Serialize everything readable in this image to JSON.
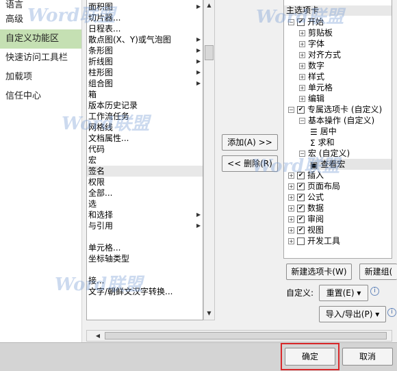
{
  "nav": {
    "items": [
      {
        "label": "语言",
        "selected": false
      },
      {
        "label": "高级",
        "selected": false
      },
      {
        "label": "自定义功能区",
        "selected": true
      },
      {
        "label": "快速访问工具栏",
        "selected": false
      },
      {
        "label": "加载项",
        "selected": false
      },
      {
        "label": "信任中心",
        "selected": false
      }
    ]
  },
  "commands": [
    {
      "label": "面积图",
      "arrow": true
    },
    {
      "label": "切片器...",
      "arrow": false
    },
    {
      "label": "日程表...",
      "arrow": false
    },
    {
      "label": "散点图(X、Y)或气泡图",
      "arrow": true
    },
    {
      "label": "条形图",
      "arrow": true
    },
    {
      "label": "折线图",
      "arrow": true
    },
    {
      "label": "柱形图",
      "arrow": true
    },
    {
      "label": "组合图",
      "arrow": true
    },
    {
      "label": "箱",
      "arrow": false
    },
    {
      "label": "版本历史记录",
      "arrow": false
    },
    {
      "label": "工作流任务",
      "arrow": false
    },
    {
      "label": "网格线",
      "arrow": false
    },
    {
      "label": "文档属性...",
      "arrow": false
    },
    {
      "label": "代码",
      "arrow": false
    },
    {
      "label": "宏",
      "arrow": false
    },
    {
      "label": "签名",
      "arrow": false,
      "selected": true
    },
    {
      "label": "权限",
      "arrow": false
    },
    {
      "label": "全部...",
      "arrow": false
    },
    {
      "label": "选",
      "arrow": false
    },
    {
      "label": "和选择",
      "arrow": true
    },
    {
      "label": "与引用",
      "arrow": true
    },
    {
      "label": "",
      "arrow": false
    },
    {
      "label": "单元格...",
      "arrow": false
    },
    {
      "label": "坐标轴类型",
      "arrow": false
    },
    {
      "label": "",
      "arrow": false
    },
    {
      "label": "接...",
      "arrow": false
    },
    {
      "label": "文字/朝鲜文汉字转换...",
      "arrow": false
    },
    {
      "label": "",
      "arrow": false
    }
  ],
  "middle": {
    "add_label": "添加(A) >>",
    "remove_label": "<< 删除(R)"
  },
  "tree": {
    "header": "主选项卡",
    "nodes": [
      {
        "label": "开始",
        "level": 0,
        "expander": "⊟",
        "checkbox": "✔"
      },
      {
        "label": "剪贴板",
        "level": 1,
        "expander": "⊞",
        "checkbox": ""
      },
      {
        "label": "字体",
        "level": 1,
        "expander": "⊞",
        "checkbox": ""
      },
      {
        "label": "对齐方式",
        "level": 1,
        "expander": "⊞",
        "checkbox": ""
      },
      {
        "label": "数字",
        "level": 1,
        "expander": "⊞",
        "checkbox": ""
      },
      {
        "label": "样式",
        "level": 1,
        "expander": "⊞",
        "checkbox": ""
      },
      {
        "label": "单元格",
        "level": 1,
        "expander": "⊞",
        "checkbox": ""
      },
      {
        "label": "编辑",
        "level": 1,
        "expander": "⊞",
        "checkbox": ""
      },
      {
        "label": "专属选项卡 (自定义)",
        "level": 0,
        "expander": "⊟",
        "checkbox": "✔"
      },
      {
        "label": "基本操作 (自定义)",
        "level": 1,
        "expander": "⊟",
        "checkbox": ""
      },
      {
        "label": "居中",
        "level": 2,
        "expander": "",
        "checkbox": "",
        "icon": "center-align-icon"
      },
      {
        "label": "求和",
        "level": 2,
        "expander": "",
        "checkbox": "",
        "icon": "sum-icon"
      },
      {
        "label": "宏 (自定义)",
        "level": 1,
        "expander": "⊟",
        "checkbox": ""
      },
      {
        "label": "查看宏",
        "level": 2,
        "expander": "",
        "checkbox": "",
        "icon": "macro-icon",
        "selected": true
      },
      {
        "label": "插入",
        "level": 0,
        "expander": "⊞",
        "checkbox": "✔"
      },
      {
        "label": "页面布局",
        "level": 0,
        "expander": "⊞",
        "checkbox": "✔"
      },
      {
        "label": "公式",
        "level": 0,
        "expander": "⊞",
        "checkbox": "✔"
      },
      {
        "label": "数据",
        "level": 0,
        "expander": "⊞",
        "checkbox": "✔"
      },
      {
        "label": "审阅",
        "level": 0,
        "expander": "⊞",
        "checkbox": "✔"
      },
      {
        "label": "视图",
        "level": 0,
        "expander": "⊞",
        "checkbox": "✔"
      },
      {
        "label": "开发工具",
        "level": 0,
        "expander": "⊞",
        "checkbox": ""
      }
    ]
  },
  "bottom": {
    "new_tab_label": "新建选项卡(W)",
    "new_group_label": "新建组(",
    "customize_label": "自定义:",
    "reset_label": "重置(E) ▾",
    "import_export_label": "导入/导出(P) ▾"
  },
  "footer": {
    "ok_label": "确定",
    "cancel_label": "取消"
  },
  "watermark": "Word联盟"
}
